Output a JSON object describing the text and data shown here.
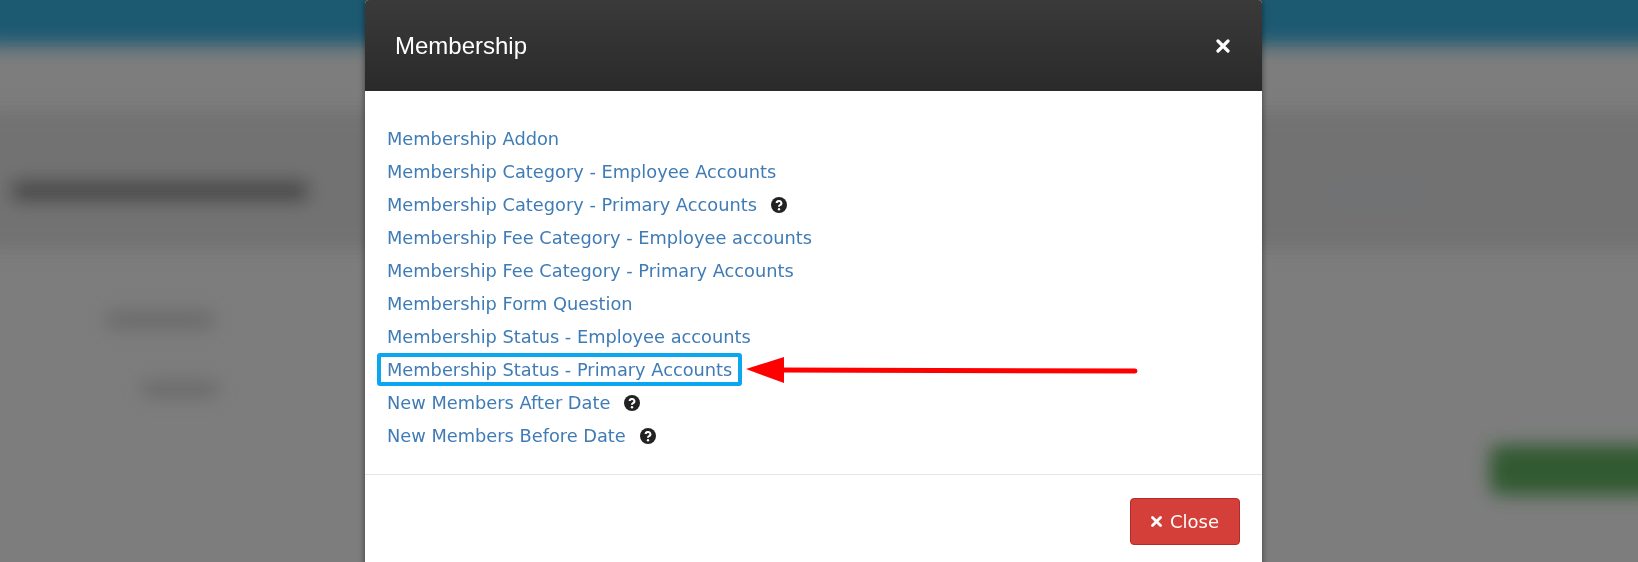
{
  "dialog": {
    "title": "Membership",
    "items": [
      {
        "text": "Membership Addon",
        "help": false,
        "highlighted": false
      },
      {
        "text": "Membership Category - Employee Accounts",
        "help": false,
        "highlighted": false
      },
      {
        "text": "Membership Category - Primary Accounts",
        "help": true,
        "highlighted": false
      },
      {
        "text": "Membership Fee Category - Employee accounts",
        "help": false,
        "highlighted": false
      },
      {
        "text": "Membership Fee Category - Primary Accounts",
        "help": false,
        "highlighted": false
      },
      {
        "text": "Membership Form Question",
        "help": false,
        "highlighted": false
      },
      {
        "text": "Membership Status - Employee accounts",
        "help": false,
        "highlighted": false
      },
      {
        "text": "Membership Status - Primary Accounts",
        "help": false,
        "highlighted": true
      },
      {
        "text": "New Members After Date",
        "help": true,
        "highlighted": false
      },
      {
        "text": "New Members Before Date",
        "help": true,
        "highlighted": false
      }
    ],
    "buttons": [
      {
        "label": "Close"
      }
    ]
  }
}
